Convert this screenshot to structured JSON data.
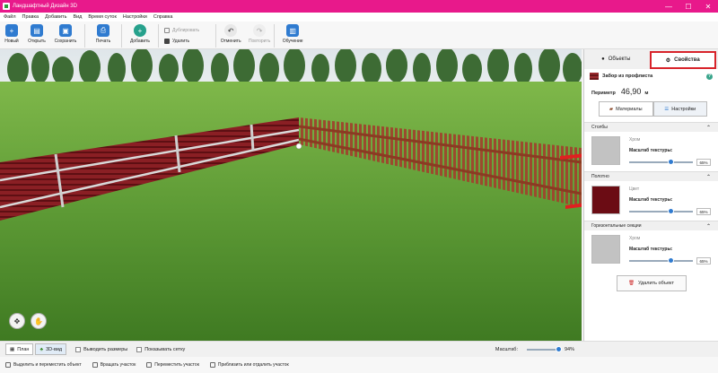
{
  "window": {
    "title": "Ландшафтный Дизайн 3D",
    "minimize": "—",
    "maximize": "☐",
    "close": "✕"
  },
  "menu": [
    "Файл",
    "Правка",
    "Добавить",
    "Вид",
    "Время суток",
    "Настройки",
    "Справка"
  ],
  "toolbar": {
    "new": "Новый",
    "open": "Открыть",
    "save": "Сохранить",
    "print": "Печать",
    "add": "Добавить",
    "duplicate": "Дублировать",
    "delete": "Удалить",
    "undo": "Отменить",
    "redo": "Повторить",
    "learn": "Обучение"
  },
  "panel": {
    "tabs": {
      "objects": "Объекты",
      "properties": "Свойства"
    },
    "object_name": "Забор из профлиста",
    "help": "?",
    "perimeter_label": "Периметр",
    "perimeter_value": "46,90",
    "perimeter_unit": "м",
    "subtabs": {
      "materials": "Материалы",
      "settings": "Настройки"
    },
    "sections": [
      {
        "title": "Столбы",
        "material": "Хром",
        "scale_label": "Масштаб текстуры:",
        "scale_value": "65%",
        "scale_fraction": 0.65,
        "swatch_color": "#c2c2c2"
      },
      {
        "title": "Полотно",
        "material": "Цвет",
        "scale_label": "Масштаб текстуры:",
        "scale_value": "65%",
        "scale_fraction": 0.65,
        "swatch_color": "#6b0c14"
      },
      {
        "title": "Горизонтальные секции",
        "material": "Хром",
        "scale_label": "Масштаб текстуры:",
        "scale_value": "65%",
        "scale_fraction": 0.65,
        "swatch_color": "#c2c2c2"
      }
    ],
    "delete_button": "Удалить объект"
  },
  "viewbar": {
    "plan": "План",
    "view3d": "3D-вид",
    "show_sizes": "Выводить размеры",
    "show_grid": "Показывать сетку",
    "scale_label": "Масштаб:",
    "scale_value": "94%",
    "scale_fraction": 0.94
  },
  "status": {
    "select": "Выделить и переместить объект",
    "rotate": "Вращать участок",
    "move": "Переместить участок",
    "zoom": "Приблизить или отдалить участок"
  },
  "colors": {
    "titlebar": "#e8198b",
    "accent": "#2f7bd0",
    "highlight": "#d8232a",
    "fence_dark": "#6b0c14"
  }
}
